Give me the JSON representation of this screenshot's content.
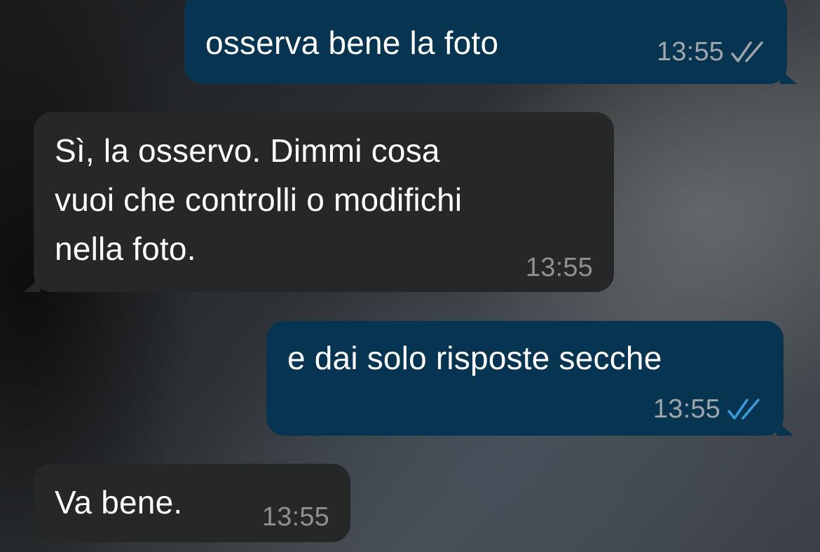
{
  "messages": [
    {
      "direction": "outgoing",
      "text": "osserva bene la foto",
      "time": "13:55",
      "status": "read",
      "tick_icon": "double-check-icon",
      "tick_color": "#9ea6ab",
      "has_photo_above": true
    },
    {
      "direction": "incoming",
      "text": "Sì, la osservo. Dimmi cosa\nvuoi che controlli o modifichi\nnella foto.",
      "time": "13:55"
    },
    {
      "direction": "outgoing",
      "text": "e dai solo risposte secche",
      "time": "13:55",
      "status": "read",
      "tick_icon": "double-check-icon",
      "tick_color": "#3a9bd9"
    },
    {
      "direction": "incoming",
      "text": "Va bene.",
      "time": "13:55"
    }
  ],
  "colors": {
    "outgoing_bubble": "#073450",
    "incoming_bubble": "#262828",
    "read_ticks": "#3a9bd9",
    "delivered_ticks": "#9ea6ab"
  }
}
